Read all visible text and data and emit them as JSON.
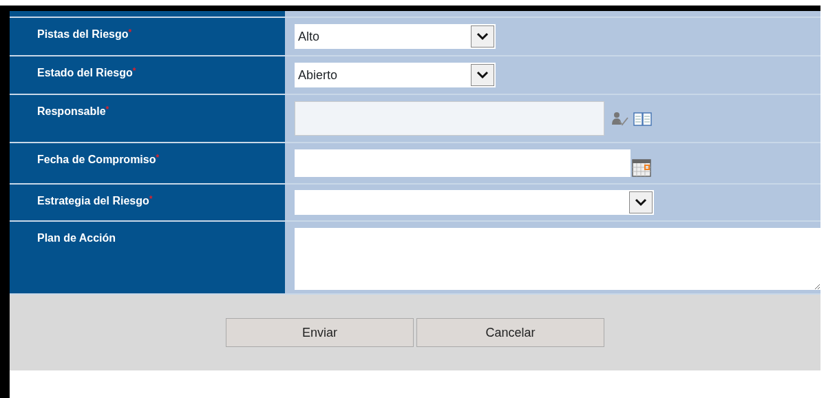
{
  "fields": [
    {
      "kind": "select",
      "label": "Pistas del Riesgo",
      "required_mark": "*",
      "value": "Alto",
      "disabled": false
    },
    {
      "kind": "select",
      "label": "Estado del Riesgo",
      "required_mark": "*",
      "value": "Abierto",
      "disabled": false
    },
    {
      "kind": "lookup",
      "label": "Responsable",
      "required_mark": "*",
      "disabled": true
    },
    {
      "kind": "date",
      "label": "Fecha de Compromiso",
      "required_mark": "*",
      "disabled": false
    },
    {
      "kind": "wideselect",
      "label": "Estrategia del Riesgo",
      "required_mark": "*",
      "disabled": false
    },
    {
      "kind": "textarea",
      "label": "Plan de Acción",
      "disabled": false
    }
  ],
  "buttons": [
    "Enviar",
    "Cancelar"
  ]
}
